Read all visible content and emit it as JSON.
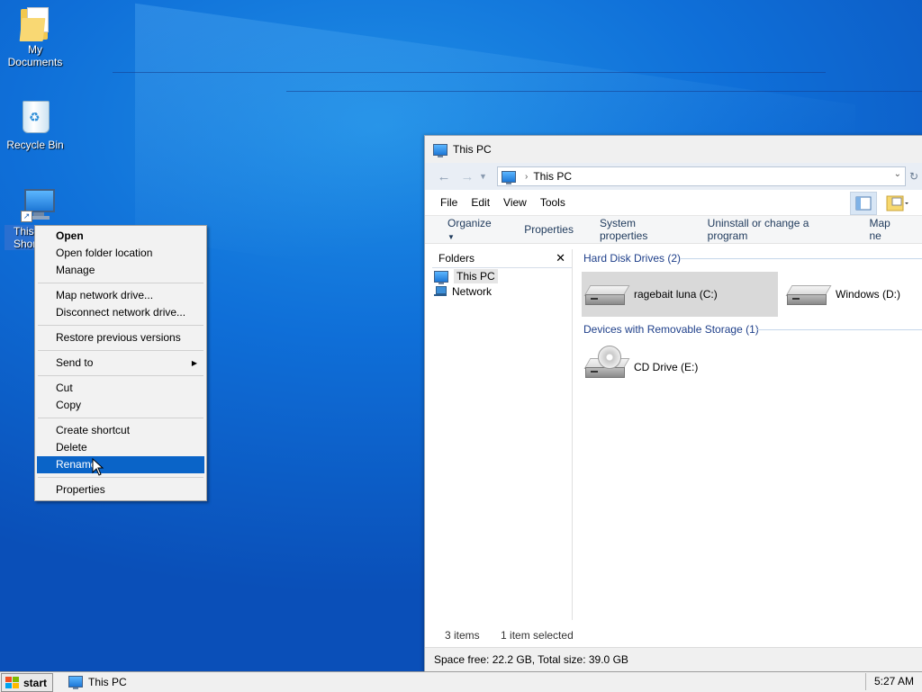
{
  "desktop": {
    "icons": [
      {
        "label_line1": "My",
        "label_line2": "Documents"
      },
      {
        "label": "Recycle Bin"
      },
      {
        "label_line1": "This",
        "label_line2": "Shor"
      }
    ]
  },
  "context_menu": {
    "items": {
      "open": "Open",
      "open_folder_location": "Open folder location",
      "manage": "Manage",
      "map_network_drive": "Map network drive...",
      "disconnect_network_drive": "Disconnect network drive...",
      "restore_previous_versions": "Restore previous versions",
      "send_to": "Send to",
      "cut": "Cut",
      "copy": "Copy",
      "create_shortcut": "Create shortcut",
      "delete": "Delete",
      "rename": "Rename",
      "properties": "Properties"
    },
    "highlighted": "Rename"
  },
  "explorer": {
    "title": "This PC",
    "address": "This PC",
    "menu": [
      "File",
      "Edit",
      "View",
      "Tools"
    ],
    "commands": {
      "organize": "Organize",
      "properties": "Properties",
      "system_properties": "System properties",
      "uninstall": "Uninstall or change a program",
      "map_network": "Map ne"
    },
    "folders_pane": {
      "header": "Folders",
      "items": [
        "This PC",
        "Network"
      ]
    },
    "groups": {
      "hard_disk": "Hard Disk Drives (2)",
      "removable": "Devices with Removable Storage (1)"
    },
    "drives": {
      "c": "ragebait luna (C:)",
      "d": "Windows (D:)",
      "e": "CD Drive (E:)"
    },
    "status": {
      "items": "3 items",
      "selected": "1 item selected"
    },
    "footer": "Space free: 22.2 GB, Total size: 39.0 GB"
  },
  "taskbar": {
    "start": "start",
    "task": "This PC",
    "clock": "5:27 AM"
  },
  "colors": {
    "highlight": "#0a64c8",
    "desktop_blue": "#0f6fd8",
    "group_header": "#1e3f8a"
  }
}
